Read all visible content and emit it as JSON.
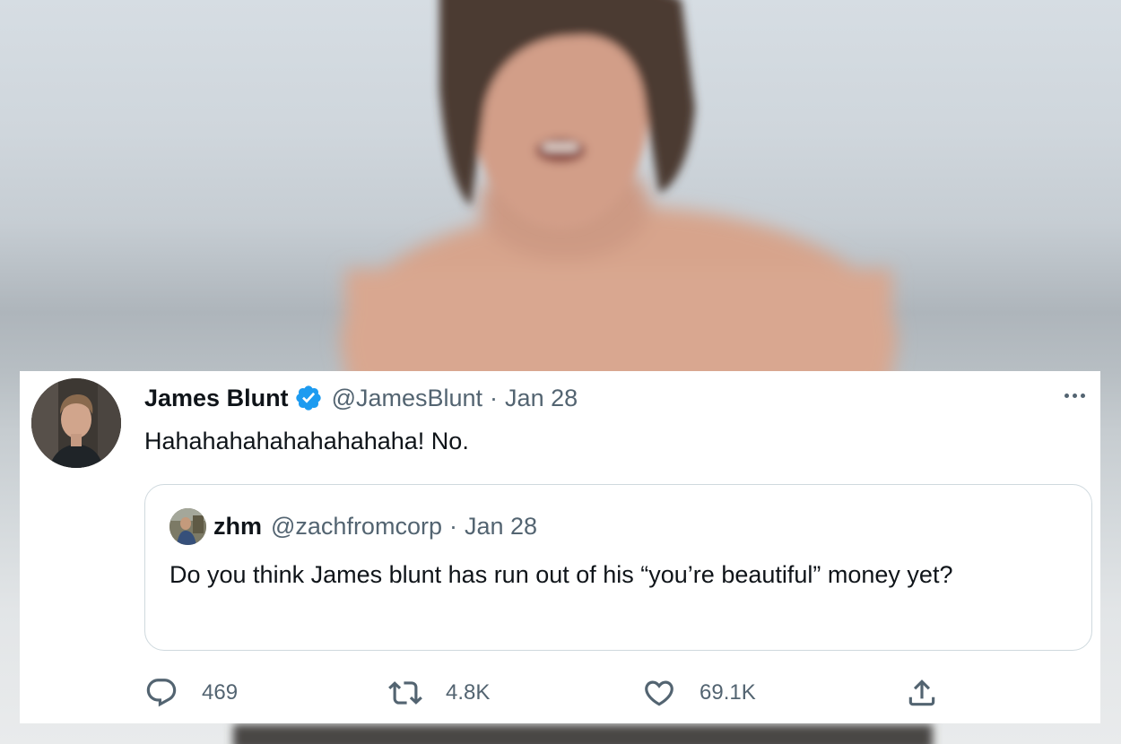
{
  "tweet": {
    "author_name": "James Blunt",
    "verified": true,
    "handle": "@JamesBlunt",
    "separator": "·",
    "date": "Jan 28",
    "text": "Hahahahahahahahahaha! No.",
    "avatar_icon": "profile-photo",
    "more_icon": "more-horizontal-icon"
  },
  "quoted_tweet": {
    "author_name": "zhm",
    "handle": "@zachfromcorp",
    "separator": "·",
    "date": "Jan 28",
    "text": "Do you think James blunt has run out of his “you’re beautiful” money yet?",
    "avatar_icon": "profile-photo"
  },
  "actions": {
    "reply": {
      "icon": "reply-icon",
      "count": "469"
    },
    "retweet": {
      "icon": "retweet-icon",
      "count": "4.8K"
    },
    "like": {
      "icon": "heart-icon",
      "count": "69.1K"
    },
    "share": {
      "icon": "share-icon"
    }
  },
  "colors": {
    "card_background": "#ffffff",
    "text_primary": "#0f1419",
    "text_secondary": "#536471",
    "verified_blue": "#1d9bf0",
    "quote_border": "#cfd9de"
  }
}
